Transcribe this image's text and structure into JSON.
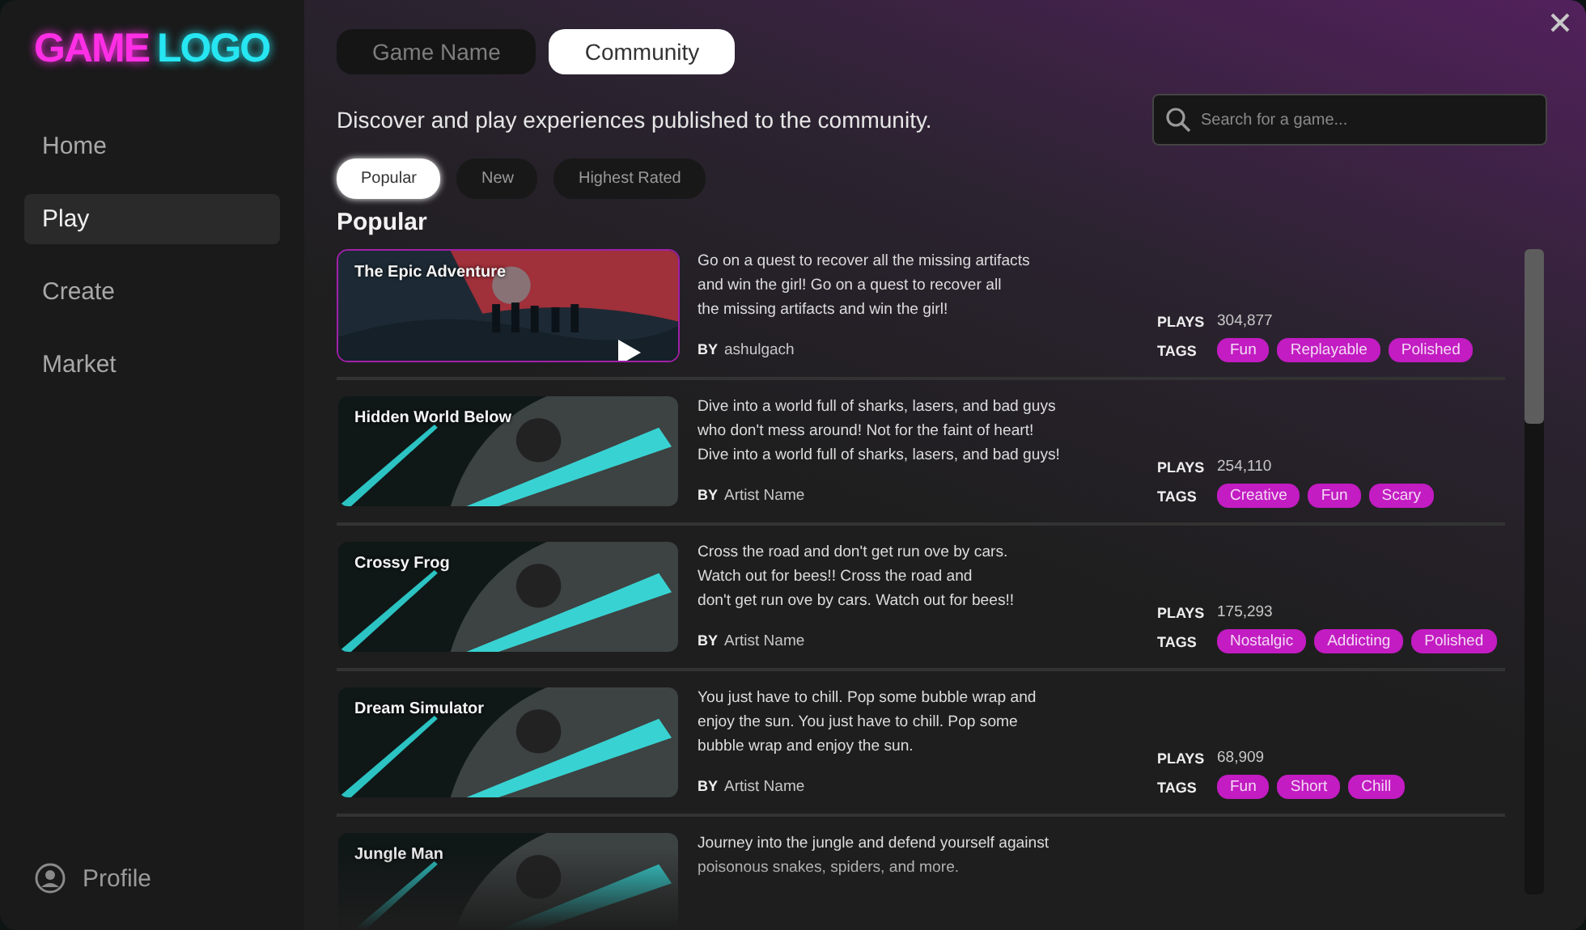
{
  "logo": {
    "part_1": "GAME",
    "part_2": "LOGO"
  },
  "sidebar": {
    "items": [
      {
        "label": "Home",
        "selected": false
      },
      {
        "label": "Play",
        "selected": true
      },
      {
        "label": "Create",
        "selected": false
      },
      {
        "label": "Market",
        "selected": false
      }
    ],
    "profile": "Profile"
  },
  "tabs": [
    {
      "label": "Game Name",
      "selected": false
    },
    {
      "label": "Community",
      "selected": true
    }
  ],
  "subtitle": "Discover and play experiences published to the community.",
  "search": {
    "placeholder": "Search for a game..."
  },
  "filters": [
    {
      "label": "Popular",
      "selected": true
    },
    {
      "label": "New",
      "selected": false
    },
    {
      "label": "Highest Rated",
      "selected": false
    }
  ],
  "section_title": "Popular",
  "games": [
    {
      "title": "The Epic Adventure",
      "kind": "adventure",
      "selected": true,
      "description_lines": [
        "Go on a quest to recover all the missing artifacts",
        "and win the girl! Go on a quest to recover all",
        "the missing artifacts and win the girl!"
      ],
      "by_label": "BY",
      "author": "ashulgach",
      "plays_label": "PLAYS",
      "plays": "304,877",
      "tags_label": "TAGS",
      "tags": [
        "Fun",
        "Replayable",
        "Polished"
      ]
    },
    {
      "title": "Hidden World Below",
      "kind": "reaper",
      "selected": false,
      "description_lines": [
        "Dive into a world full of sharks, lasers, and bad guys",
        "who don't mess around! Not for the faint of heart!",
        "Dive into a world full of sharks, lasers, and bad guys!"
      ],
      "by_label": "BY",
      "author": "Artist Name",
      "plays_label": "PLAYS",
      "plays": "254,110",
      "tags_label": "TAGS",
      "tags": [
        "Creative",
        "Fun",
        "Scary"
      ]
    },
    {
      "title": "Crossy Frog",
      "kind": "reaper",
      "selected": false,
      "description_lines": [
        "Cross the road and don't get run ove by cars.",
        "Watch out for bees!! Cross the road and",
        "don't get run ove by cars. Watch out for bees!!"
      ],
      "by_label": "BY",
      "author": "Artist Name",
      "plays_label": "PLAYS",
      "plays": "175,293",
      "tags_label": "TAGS",
      "tags": [
        "Nostalgic",
        "Addicting",
        "Polished"
      ]
    },
    {
      "title": "Dream Simulator",
      "kind": "reaper",
      "selected": false,
      "description_lines": [
        "You just have to chill. Pop some bubble wrap and",
        "enjoy the sun. You just have to chill. Pop some",
        "bubble wrap and enjoy the sun."
      ],
      "by_label": "BY",
      "author": "Artist Name",
      "plays_label": "PLAYS",
      "plays": "68,909",
      "tags_label": "TAGS",
      "tags": [
        "Fun",
        "Short",
        "Chill"
      ]
    },
    {
      "title": "Jungle Man",
      "kind": "reaper",
      "selected": false,
      "description_lines": [
        "Journey into the jungle and defend yourself against",
        "poisonous snakes, spiders, and more."
      ]
    }
  ]
}
